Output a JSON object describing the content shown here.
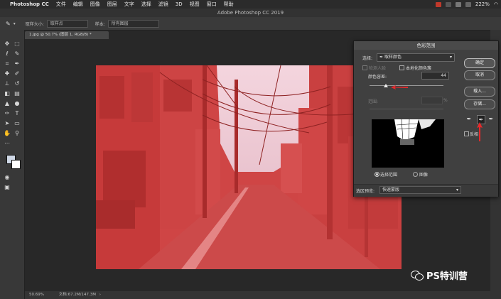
{
  "menubar": {
    "app_name": "Photoshop CC",
    "items": [
      "文件",
      "编辑",
      "图像",
      "图层",
      "文字",
      "选择",
      "滤镜",
      "3D",
      "视图",
      "窗口",
      "帮助"
    ],
    "battery": "222%"
  },
  "window_title": "Adobe Photoshop CC 2019",
  "options_bar": {
    "sample_size_label": "取样大小:",
    "sample_size_value": "取样点",
    "sample_label": "样本:",
    "sample_value": "所有图层"
  },
  "document": {
    "tab_label": "1.jpg @ 50.7% (图层 1, RGB/8) *",
    "zoom": "50.69%",
    "file_info": "文档:67.2M/147.3M"
  },
  "dialog": {
    "title": "色彩范围",
    "select_label": "选择:",
    "select_value": "取样颜色",
    "detect_faces_label": "检测人脸",
    "localized_clusters_label": "本地化颜色簇",
    "fuzziness_label": "颜色容差:",
    "fuzziness_value": "44",
    "fuzziness_fraction": 0.22,
    "range_label": "范围:",
    "range_unit": "%",
    "radio_selection": "选择范围",
    "radio_image": "图像",
    "preview_label": "选区预览:",
    "preview_value": "快速蒙版",
    "buttons": {
      "ok": "确定",
      "cancel": "取消",
      "load": "载入...",
      "save": "存储..."
    },
    "invert_label": "反相"
  },
  "watermark": "PS特训营",
  "colors": {
    "accent_red": "#e8282a",
    "overlay_red": "#d43c3c",
    "panel_bg": "#404040"
  }
}
